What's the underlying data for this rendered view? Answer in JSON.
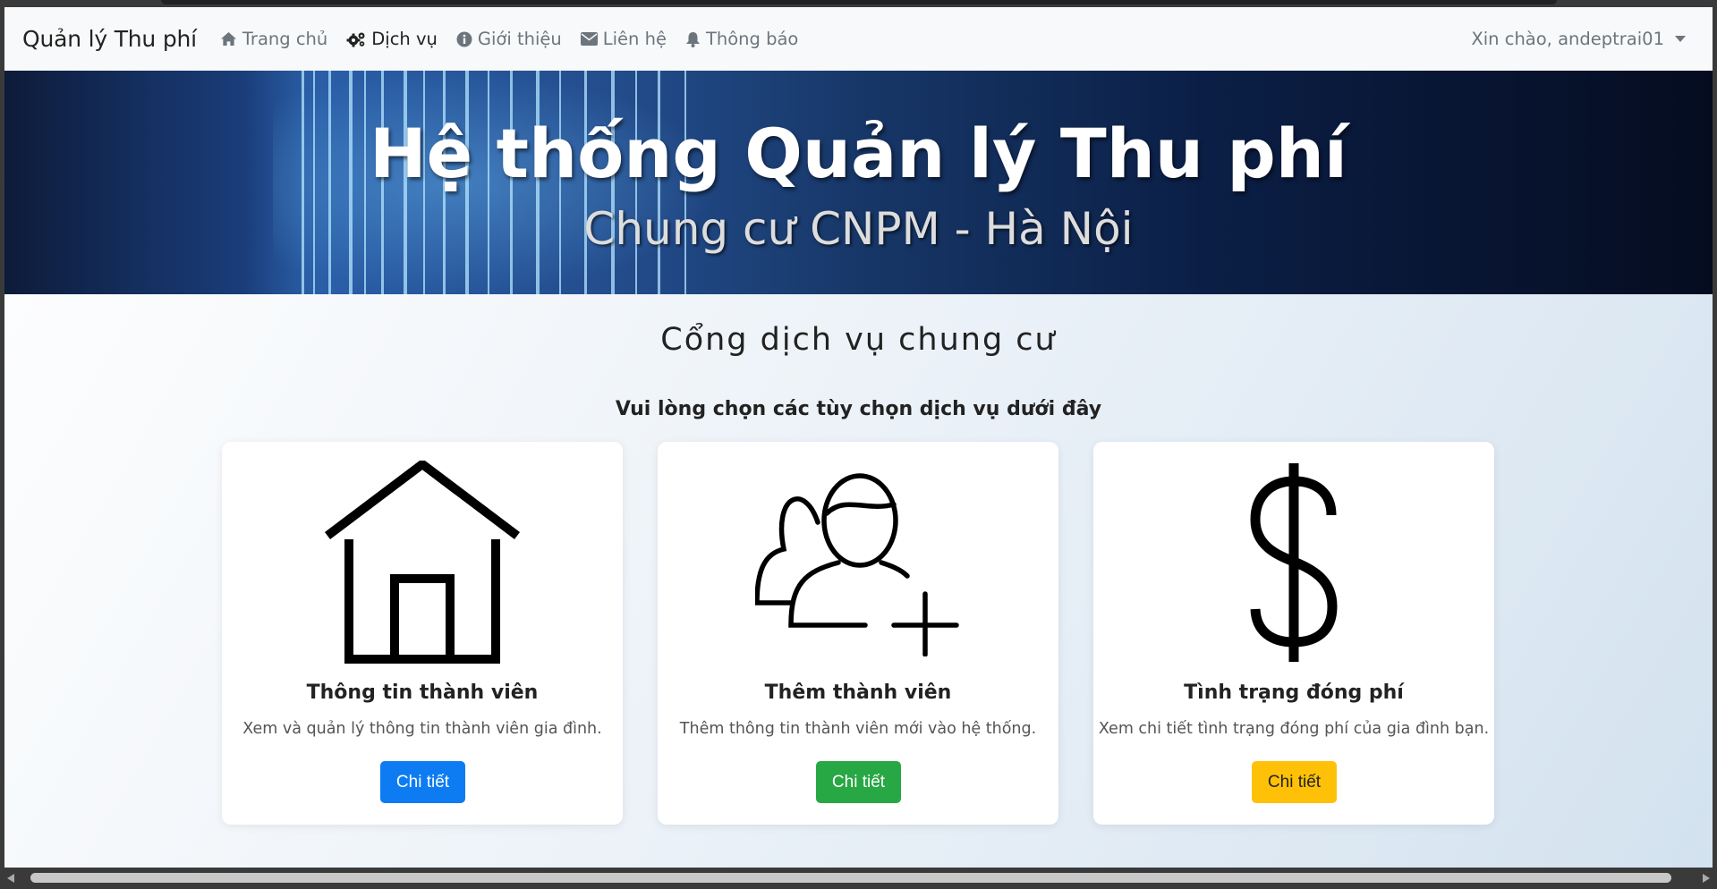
{
  "navbar": {
    "brand": "Quản lý Thu phí",
    "items": [
      {
        "label": "Trang chủ",
        "icon": "home-icon",
        "active": false
      },
      {
        "label": "Dịch vụ",
        "icon": "gears-icon",
        "active": true
      },
      {
        "label": "Giới thiệu",
        "icon": "info-icon",
        "active": false
      },
      {
        "label": "Liên hệ",
        "icon": "envelope-icon",
        "active": false
      },
      {
        "label": "Thông báo",
        "icon": "bell-icon",
        "active": false
      }
    ],
    "user_greeting": "Xin chào, andeptrai01"
  },
  "hero": {
    "title": "Hệ thống Quản lý Thu phí",
    "subtitle": "Chung cư CNPM - Hà Nội"
  },
  "main": {
    "title": "Cổng dịch vụ chung cư",
    "subtitle": "Vui lòng chọn các tùy chọn dịch vụ dưới đây",
    "cards": [
      {
        "icon": "house-icon",
        "title": "Thông tin thành viên",
        "desc": "Xem và quản lý thông tin thành viên gia đình.",
        "button": "Chi tiết",
        "color": "#0d7cf2"
      },
      {
        "icon": "add-user-icon",
        "title": "Thêm thành viên",
        "desc": "Thêm thông tin thành viên mới vào hệ thống.",
        "button": "Chi tiết",
        "color": "#28a745"
      },
      {
        "icon": "dollar-icon",
        "title": "Tình trạng đóng phí",
        "desc": "Xem chi tiết tình trạng đóng phí của gia đình bạn.",
        "button": "Chi tiết",
        "color": "#ffc107"
      }
    ]
  }
}
